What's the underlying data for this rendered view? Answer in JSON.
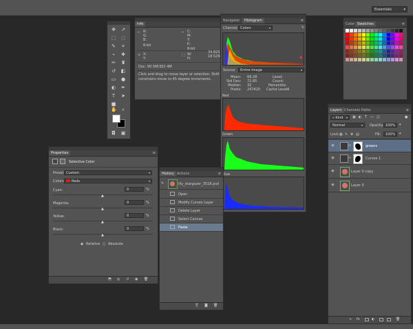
{
  "topbar": {
    "workspace": "Essentials"
  },
  "info": {
    "tab": "Info",
    "rgb_labels": [
      "R:",
      "G:",
      "B:"
    ],
    "cmyk_labels": [
      "C:",
      "M:",
      "Y:",
      "K:"
    ],
    "bit_left": "8-bit",
    "bit_right": "8-bit",
    "x_label": "X:",
    "y_label": "Y:",
    "x_value": "34.825",
    "y_value": "18.529",
    "w_label": "W:",
    "h_label": "H:",
    "doc": "Doc: 90.5M/302.4M",
    "hint": "Click and drag to move layer or selection. Shift constrains move to 45 degree increments."
  },
  "histogram": {
    "tabs": [
      "Navigator",
      "Histogram"
    ],
    "channel_label": "Channel:",
    "channel_value": "Colors",
    "source_label": "Source:",
    "source_value": "Entire Image",
    "stats_left": [
      {
        "label": "Mean:",
        "value": "69.28"
      },
      {
        "label": "Std Dev:",
        "value": "72.85"
      },
      {
        "label": "Median:",
        "value": "32"
      },
      {
        "label": "Pixels:",
        "value": "247420"
      }
    ],
    "stats_right": [
      {
        "label": "Level:",
        "value": ""
      },
      {
        "label": "Count:",
        "value": ""
      },
      {
        "label": "Percentile:",
        "value": ""
      },
      {
        "label": "Cache Level:",
        "value": "4"
      }
    ],
    "channels": [
      "Red",
      "Green",
      "Blue"
    ],
    "colors": {
      "red": "#ff2a00",
      "green": "#19ff19",
      "blue": "#1a2bff"
    }
  },
  "swatches": {
    "tabs": [
      "Color",
      "Swatches"
    ]
  },
  "layers": {
    "tabs": [
      "Layers",
      "Channels",
      "Paths"
    ],
    "kind": "Kind",
    "blend_mode": "Normal",
    "opacity_label": "Opacity:",
    "opacity": "100%",
    "lock_label": "Lock:",
    "fill_label": "Fill:",
    "fill": "100%",
    "items": [
      {
        "name": "greens"
      },
      {
        "name": "Curves 1"
      },
      {
        "name": "Layer 0 copy"
      },
      {
        "name": "Layer 0"
      }
    ]
  },
  "properties": {
    "tab": "Properties",
    "title": "Selective Color",
    "preset_label": "Preset:",
    "preset_value": "Custom",
    "colors_label": "Colors:",
    "colors_value": "Reds",
    "sliders": [
      {
        "label": "Cyan:",
        "value": "0",
        "unit": "%"
      },
      {
        "label": "Magenta:",
        "value": "0",
        "unit": "%"
      },
      {
        "label": "Yellow:",
        "value": "0",
        "unit": "%"
      },
      {
        "label": "Black:",
        "value": "0",
        "unit": "%"
      }
    ],
    "relative": "Relative",
    "absolute": "Absolute"
  },
  "history": {
    "tabs": [
      "History",
      "Actions"
    ],
    "snapshot": "lily_stargazer_3518.psd",
    "items": [
      "Open",
      "Modify Curves Layer",
      "Delete Layer",
      "Select Canvas",
      "Paste"
    ],
    "selected_index": 4
  }
}
